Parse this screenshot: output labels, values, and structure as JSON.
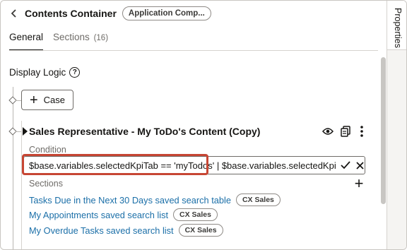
{
  "header": {
    "title": "Contents Container",
    "badge": "Application Comp..."
  },
  "tabs": [
    {
      "label": "General",
      "count": ""
    },
    {
      "label": "Sections",
      "count": "(16)"
    }
  ],
  "side_rail": {
    "label": "Properties"
  },
  "display_logic": {
    "label": "Display Logic",
    "help_glyph": "?"
  },
  "case_button": {
    "label": "Case"
  },
  "case_card": {
    "title": "Sales Representative - My ToDo's Content (Copy)",
    "condition_label": "Condition",
    "condition_value": "$base.variables.selectedKpiTab == 'myTodos' | $base.variables.selectedKpiTa",
    "sections_label": "Sections",
    "sections": [
      {
        "name": "Tasks Due in the Next 30 Days saved search table",
        "tag": "CX Sales"
      },
      {
        "name": "My Appointments saved search list",
        "tag": "CX Sales"
      },
      {
        "name": "My Overdue Tasks saved search list",
        "tag": "CX Sales"
      }
    ]
  },
  "colors": {
    "link": "#1b6fa8",
    "highlight": "#c74634",
    "text": "#161513"
  }
}
